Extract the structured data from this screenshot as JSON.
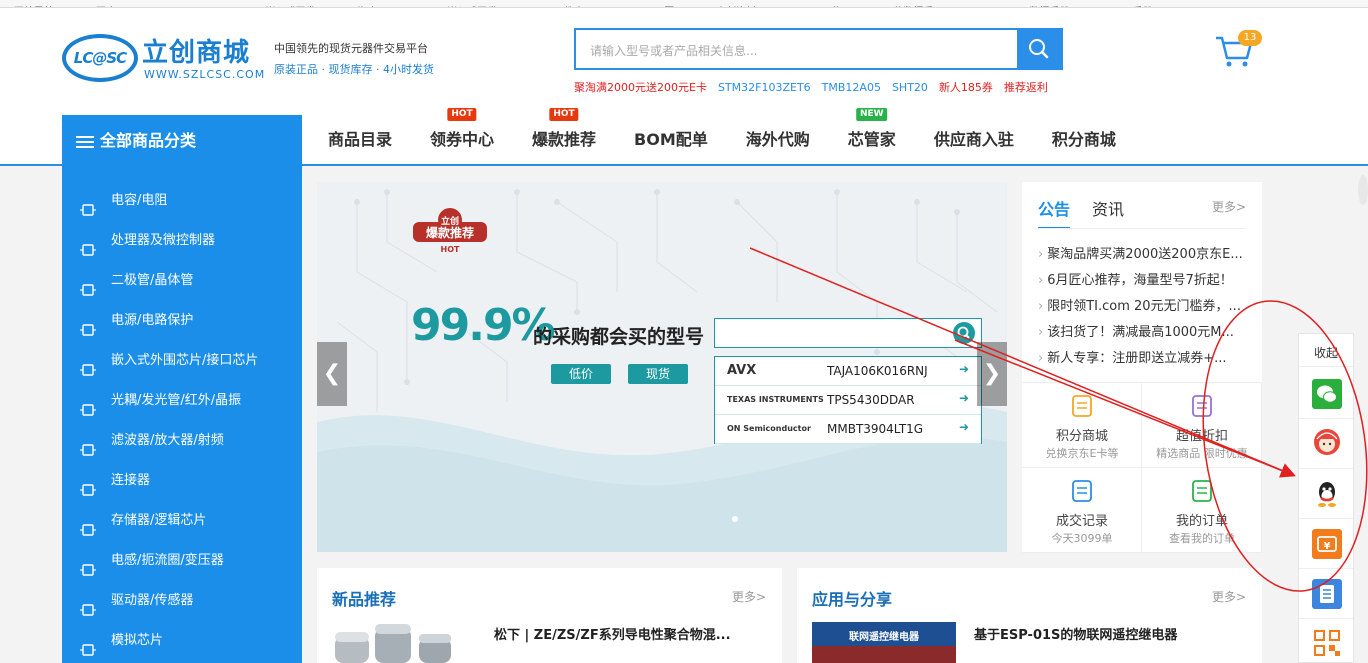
{
  "bookmarks": [
    "网站导航",
    "百度一下",
    "Microsoft",
    "嵌入式开发",
    "淘宝(PCB)",
    "嵌入式开发",
    "AD元件库",
    "Google 图",
    "立创资料",
    "BOM元件",
    "元件数据手",
    "qk",
    "数据手册",
    "STM手册",
    "stm"
  ],
  "header": {
    "logo_badge": "LC@SC",
    "logo_cn": "立创商城",
    "logo_en": "WWW.SZLCSC.COM",
    "slogan_1": "中国领先的现货元器件交易平台",
    "slogan_2": "原装正品 · 现货库存 · 4小时发货",
    "search_placeholder": "请输入型号或者产品相关信息...",
    "hot_links": [
      {
        "text": "聚淘满2000元送200元E卡",
        "color": "red"
      },
      {
        "text": "STM32F103ZET6",
        "color": "blue"
      },
      {
        "text": "TMB12A05",
        "color": "blue"
      },
      {
        "text": "SHT20",
        "color": "blue"
      },
      {
        "text": "新人185券",
        "color": "red"
      },
      {
        "text": "推荐返利",
        "color": "red"
      }
    ],
    "cart_count": "13"
  },
  "nav": {
    "all_categories": "全部商品分类",
    "items": [
      {
        "label": "商品目录",
        "tag": ""
      },
      {
        "label": "领券中心",
        "tag": "HOT"
      },
      {
        "label": "爆款推荐",
        "tag": "HOT"
      },
      {
        "label": "BOM配单",
        "tag": ""
      },
      {
        "label": "海外代购",
        "tag": ""
      },
      {
        "label": "芯管家",
        "tag": "NEW"
      },
      {
        "label": "供应商入驻",
        "tag": ""
      },
      {
        "label": "积分商城",
        "tag": ""
      }
    ]
  },
  "categories": [
    "电容/电阻",
    "处理器及微控制器",
    "二极管/晶体管",
    "电源/电路保护",
    "嵌入式外围芯片/接口芯片",
    "光耦/发光管/红外/晶振",
    "滤波器/放大器/射频",
    "连接器",
    "存储器/逻辑芯片",
    "电感/扼流圈/变压器",
    "驱动器/传感器",
    "模拟芯片"
  ],
  "banner": {
    "badge_top": "立创",
    "badge_main": "爆款推荐",
    "badge_sub": "HOT",
    "percent": "99.9%",
    "tagline": "的采购都会买的型号",
    "pill_low": "低价",
    "pill_stock": "现货",
    "parts": [
      {
        "brand": "AVX",
        "pn": "TAJA106K016RNJ"
      },
      {
        "brand": "TEXAS INSTRUMENTS",
        "pn": "TPS5430DDAR"
      },
      {
        "brand": "ON Semiconductor",
        "pn": "MMBT3904LT1G"
      }
    ]
  },
  "notice": {
    "tab_active": "公告",
    "tab_other": "资讯",
    "more": "更多>",
    "news": [
      "聚淘品牌买满2000送200京东E...",
      "6月匠心推荐，海量型号7折起！",
      "限时领TI.com 20元无门槛券，...",
      "该扫货了！满减最高1000元M...",
      "新人专享：注册即送立减券+..."
    ],
    "grid": [
      {
        "title": "积分商城",
        "sub": "兑换京东E卡等"
      },
      {
        "title": "超值折扣",
        "sub": "精选商品 限时优惠"
      },
      {
        "title": "成交记录",
        "sub": "今天3099单"
      },
      {
        "title": "我的订单",
        "sub": "查看我的订单"
      }
    ]
  },
  "sections": {
    "new_products": {
      "title": "新品推荐",
      "more": "更多>",
      "item": "松下 | ZE/ZS/ZF系列导电性聚合物混..."
    },
    "apps": {
      "title": "应用与分享",
      "more": "更多>",
      "item": "基于ESP-01S的物联网遥控继电器",
      "thumb_label": "联网遥控继电器"
    }
  },
  "right_toolbar": {
    "fold": "收起",
    "buttons": [
      "wechat",
      "customer-service",
      "qq",
      "coupon",
      "notes",
      "qr-code"
    ]
  },
  "colors": {
    "brand_blue": "#1a8ee8",
    "teal": "#1d9aa0",
    "hot_red": "#e8380d",
    "new_green": "#2ab24a",
    "annotation_red": "#e02020"
  }
}
